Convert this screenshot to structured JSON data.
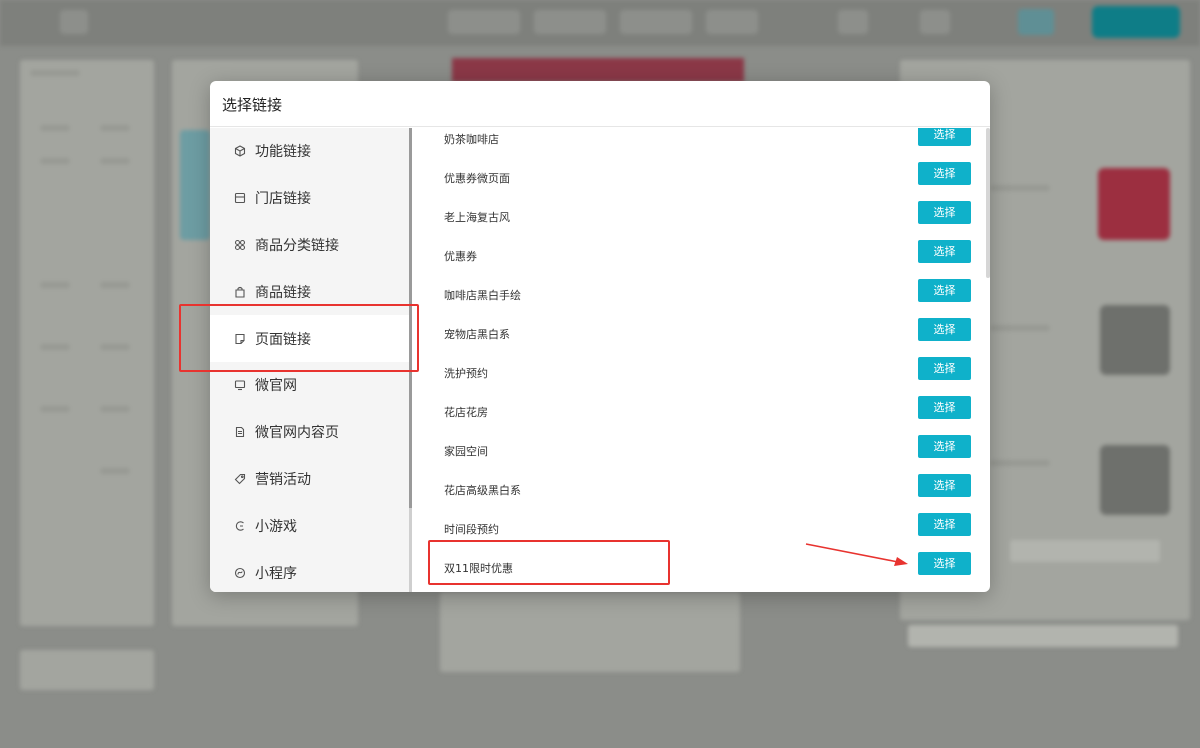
{
  "modal": {
    "title": "选择链接"
  },
  "sidebar": {
    "items": [
      {
        "label": "功能链接",
        "icon": "cube-icon"
      },
      {
        "label": "门店链接",
        "icon": "store-icon"
      },
      {
        "label": "商品分类链接",
        "icon": "category-icon"
      },
      {
        "label": "商品链接",
        "icon": "bag-icon"
      },
      {
        "label": "页面链接",
        "icon": "page-icon",
        "active": true
      },
      {
        "label": "微官网",
        "icon": "monitor-icon"
      },
      {
        "label": "微官网内容页",
        "icon": "document-icon"
      },
      {
        "label": "营销活动",
        "icon": "tag-icon"
      },
      {
        "label": "小游戏",
        "icon": "game-icon"
      },
      {
        "label": "小程序",
        "icon": "miniprogram-icon"
      }
    ]
  },
  "pages": {
    "select_label": "选择",
    "rows": [
      "奶茶咖啡店",
      "优惠券微页面",
      "老上海复古风",
      "优惠券",
      "咖啡店黑白手绘",
      "宠物店黑白系",
      "洗护预约",
      "花店花房",
      "家园空间",
      "花店高级黑白系",
      "时间段预约",
      "双11限时优惠"
    ]
  },
  "colors": {
    "accent": "#0fb1ca",
    "annotation": "#e8332f"
  }
}
